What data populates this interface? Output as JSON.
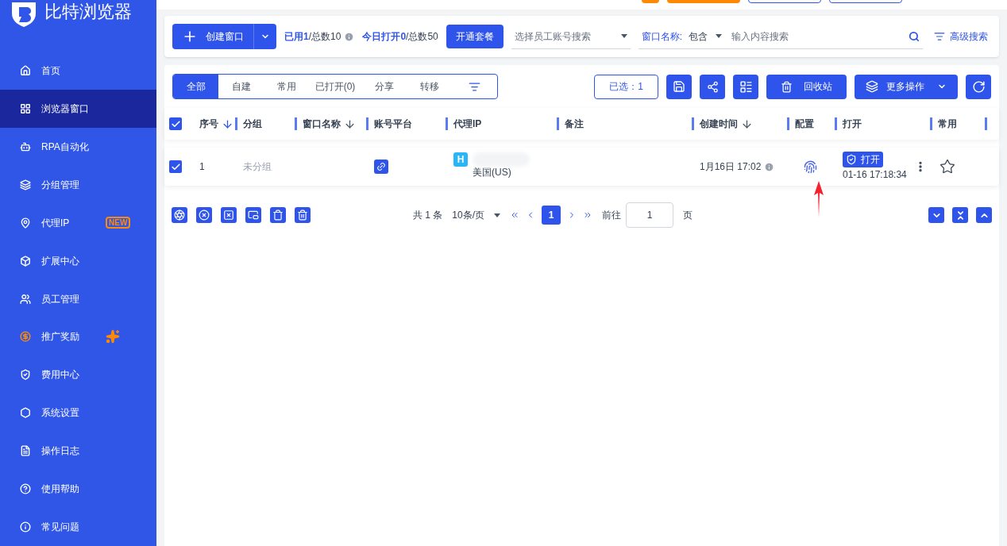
{
  "app": {
    "name": "比特浏览器"
  },
  "sidebar": {
    "items": [
      {
        "label": "首页",
        "selected": false
      },
      {
        "label": "浏览器窗口",
        "selected": true
      },
      {
        "label": "RPA自动化",
        "selected": false
      },
      {
        "label": "分组管理",
        "selected": false
      },
      {
        "label": "代理IP",
        "selected": false,
        "badge": "NEW"
      },
      {
        "label": "扩展中心",
        "selected": false
      },
      {
        "label": "员工管理",
        "selected": false
      },
      {
        "label": "推广奖励",
        "selected": false,
        "highlight": true
      },
      {
        "label": "费用中心",
        "selected": false
      },
      {
        "label": "系统设置",
        "selected": false
      },
      {
        "label": "操作日志",
        "selected": false
      },
      {
        "label": "使用帮助",
        "selected": false
      },
      {
        "label": "常见问题",
        "selected": false
      }
    ]
  },
  "toolbar": {
    "create_button": "创建窗口",
    "usage": "**已用1**/总数10",
    "today": "**今日打开0**/总数50",
    "package_button": "开通套餐",
    "staff_select": {
      "placeholder": "选择员工账号搜索"
    },
    "name_filter": {
      "label": "窗口名称:",
      "mode": "包含"
    },
    "search": {
      "placeholder": "输入内容搜索"
    },
    "advanced_search": "高级搜索"
  },
  "tabs": [
    {
      "label": "全部",
      "selected": true
    },
    {
      "label": "自建",
      "selected": false
    },
    {
      "label": "常用",
      "selected": false
    },
    {
      "label": "已打开(0)",
      "selected": false
    },
    {
      "label": "分享",
      "selected": false
    },
    {
      "label": "转移",
      "selected": false
    }
  ],
  "actions": {
    "selected_count": "已选：1",
    "recycle_button": "回收站",
    "more_button": "更多操作"
  },
  "table": {
    "all_checked": true,
    "columns": [
      {
        "label": "序号",
        "sort_active": true
      },
      {
        "label": "分组"
      },
      {
        "label": "窗口名称",
        "sort_active": false
      },
      {
        "label": "账号平台"
      },
      {
        "label": "代理IP"
      },
      {
        "label": "备注"
      },
      {
        "label": "创建时间",
        "sort_active": false
      },
      {
        "label": "配置"
      },
      {
        "label": "打开"
      },
      {
        "label": "常用"
      }
    ],
    "rows": [
      {
        "checked": true,
        "index": "1",
        "group": "未分组",
        "proxy_type": "H",
        "proxy_location": "美国(US)",
        "created": "1月16日 17:02",
        "open_button": "打开",
        "opened_at": "01-16 17:18:34",
        "favorite": false
      }
    ]
  },
  "pagination": {
    "total": "共 1 条",
    "page_size": "10条/页",
    "pages": [
      {
        "label": "1",
        "selected": true
      }
    ],
    "goto_label": "前往",
    "goto_value": "1",
    "page_suffix": "页"
  }
}
